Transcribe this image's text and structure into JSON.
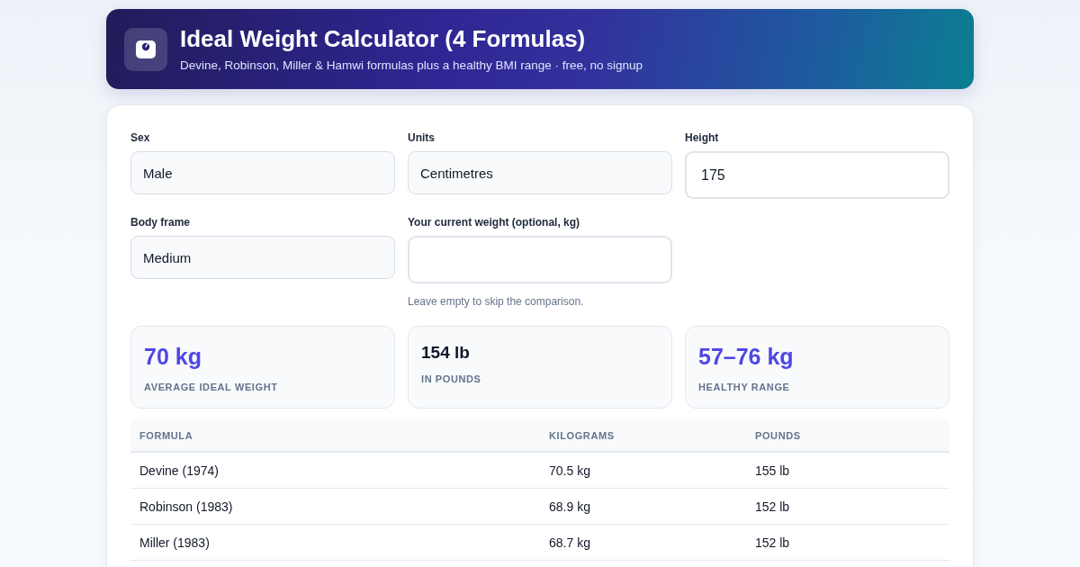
{
  "header": {
    "title": "Ideal Weight Calculator (4 Formulas)",
    "subtitle": "Devine, Robinson, Miller & Hamwi formulas plus a healthy BMI range · free, no signup"
  },
  "form": {
    "fields": [
      {
        "label": "Sex",
        "kind": "select",
        "value": "Male"
      },
      {
        "label": "Units",
        "kind": "select",
        "value": "Centimetres"
      },
      {
        "label": "Height",
        "kind": "input",
        "value": "175"
      },
      {
        "label": "Body frame",
        "kind": "select",
        "value": "Medium"
      },
      {
        "label": "Your current weight (optional, kg)",
        "kind": "input",
        "hint": "Leave empty to skip the comparison."
      }
    ]
  },
  "stats": [
    {
      "value": "70 kg",
      "label": "AVERAGE IDEAL WEIGHT",
      "kind": "accent"
    },
    {
      "value": "154 lb",
      "label": "IN POUNDS",
      "kind": "plain"
    },
    {
      "value": "57–76 kg",
      "label": "HEALTHY RANGE",
      "kind": "accent"
    }
  ],
  "table": {
    "columns": [
      "FORMULA",
      "KILOGRAMS",
      "POUNDS"
    ],
    "rows": [
      [
        "Devine (1974)",
        "70.5 kg",
        "155 lb"
      ],
      [
        "Robinson (1983)",
        "68.9 kg",
        "152 lb"
      ],
      [
        "Miller (1983)",
        "68.7 kg",
        "152 lb"
      ]
    ]
  }
}
